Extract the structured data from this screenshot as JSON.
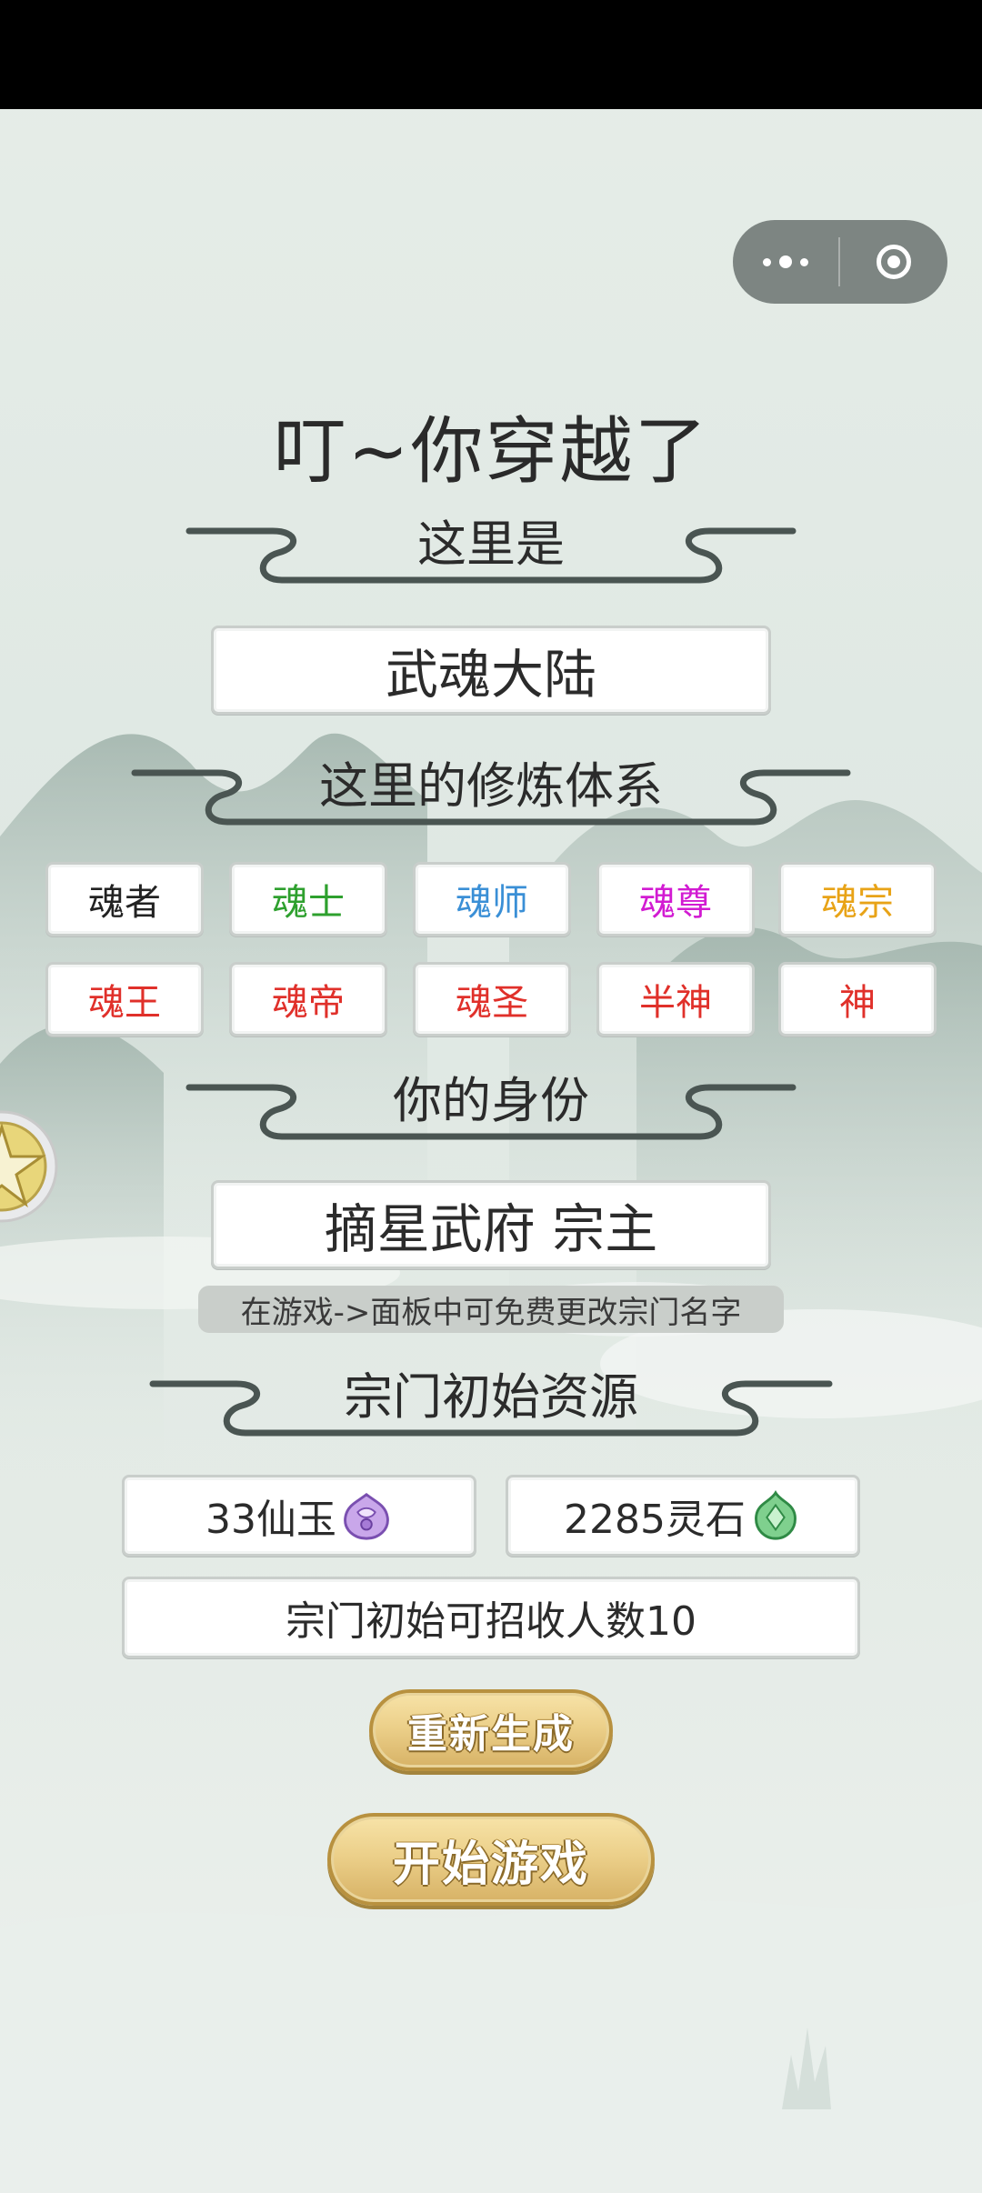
{
  "title": "叮~你穿越了",
  "sections": {
    "world_heading": "这里是",
    "system_heading": "这里的修炼体系",
    "identity_heading": "你的身份",
    "resources_heading": "宗门初始资源"
  },
  "world_name": "武魂大陆",
  "realms_row1": [
    {
      "label": "魂者",
      "color": "#222222"
    },
    {
      "label": "魂士",
      "color": "#2ea02e"
    },
    {
      "label": "魂师",
      "color": "#3a8fd6"
    },
    {
      "label": "魂尊",
      "color": "#d21bd2"
    },
    {
      "label": "魂宗",
      "color": "#e8a317"
    }
  ],
  "realms_row2": [
    {
      "label": "魂王",
      "color": "#e0302a"
    },
    {
      "label": "魂帝",
      "color": "#e0302a"
    },
    {
      "label": "魂圣",
      "color": "#e0302a"
    },
    {
      "label": "半神",
      "color": "#e0302a"
    },
    {
      "label": "神",
      "color": "#e0302a"
    }
  ],
  "identity": "摘星武府 宗主",
  "rename_hint": "在游戏->面板中可免费更改宗门名字",
  "resources": {
    "jade_text": "33仙玉",
    "jade_icon": "purple-jade-icon",
    "stone_text": "2285灵石",
    "stone_icon": "green-spirit-stone-icon",
    "recruit_text": "宗门初始可招收人数10"
  },
  "buttons": {
    "regenerate": "重新生成",
    "start": "开始游戏"
  },
  "capsule": {
    "more_icon": "more-dots-icon",
    "close_icon": "target-close-icon"
  }
}
